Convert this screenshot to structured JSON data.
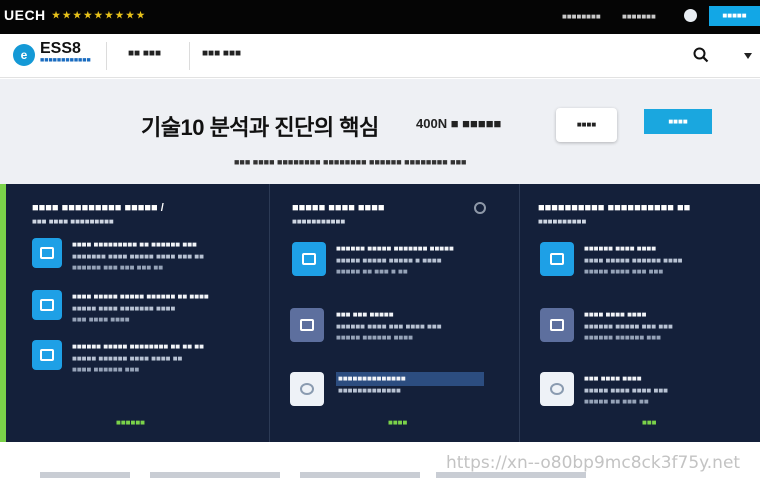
{
  "topbar": {
    "brand": "UECH",
    "tagline": "★ ★ ★ ★ ★ ★ ★ ★ ★",
    "links": [
      "■■■■■■■■",
      "■■■■■■■"
    ],
    "cta_label": "■■■■■"
  },
  "nav": {
    "logo_mark": "e",
    "logo_text": "ESS8",
    "logo_sub": "■■■■■■■■■■■■",
    "items": [
      "■■ ■■■",
      "■■■ ■■■"
    ]
  },
  "hero": {
    "headline": "기술10 분석과 진단의 핵심",
    "headline_suffix": "400N ■ ■■■■■",
    "btn_white": "■■■■",
    "btn_blue": "■■■■",
    "subline": "■■■ ■■■■ ■■■■■■■■ ■■■■■■■■ ■■■■■■ ■■■■■■■■ ■■■"
  },
  "columns": [
    {
      "title": "■■■■ ■■■■■■■■■ ■■■■■ /",
      "subtitle": "■■■ ■■■■ ■■■■■■■■■",
      "items": [
        {
          "icon": "monitor-icon",
          "l1": "■■■■ ■■■■■■■■■ ■■ ■■■■■■ ■■■",
          "l2": "■■■■■■■ ■■■■ ■■■■■ ■■■■ ■■■ ■■",
          "l3": "■■■■■■ ■■■ ■■■ ■■■ ■■"
        },
        {
          "icon": "document-icon",
          "l1": "■■■■ ■■■■■ ■■■■■ ■■■■■■ ■■ ■■■■",
          "l2": "■■■■■ ■■■■ ■■■■■■■ ■■■■",
          "l3": "■■■ ■■■■ ■■■■"
        },
        {
          "icon": "chart-icon",
          "l1": "■■■■■■ ■■■■■ ■■■■■■■■ ■■ ■■ ■■",
          "l2": "■■■■■ ■■■■■■ ■■■■ ■■■■ ■■",
          "l3": "■■■■ ■■■■■■ ■■■"
        }
      ],
      "footer": "■■■■■■"
    },
    {
      "title": "■■■■■ ■■■■ ■■■■",
      "subtitle": "■■■■■■■■■■■",
      "items": [
        {
          "icon": "tablet-icon",
          "l1": "■■■■■■ ■■■■■ ■■■■■■■ ■■■■■",
          "l2": "■■■■■ ■■■■■ ■■■■■ ■ ■■■■",
          "l3": "■■■■■ ■■ ■■■ ■ ■■"
        },
        {
          "icon": "gear-icon",
          "l1": "■■■ ■■■ ■■■■■",
          "l2": "■■■■■■ ■■■■ ■■■ ■■■■ ■■■",
          "l3": "■■■■■ ■■■■■■ ■■■■"
        },
        {
          "icon": "disc-icon",
          "l1": "■■■■■■■■■■■■■■",
          "l2": "■■■■■■■■■■■■■",
          "l3": ""
        }
      ],
      "footer": "■■■■"
    },
    {
      "title": "■■■■■■■■■■ ■■■■■■■■■■ ■■",
      "subtitle": "■■■■■■■■■■",
      "items": [
        {
          "icon": "window-icon",
          "l1": "■■■■■■ ■■■■ ■■■■",
          "l2": "■■■■ ■■■■■ ■■■■■■ ■■■■",
          "l3": "■■■■■ ■■■■ ■■■ ■■■"
        },
        {
          "icon": "calendar-icon",
          "l1": "■■■■ ■■■■ ■■■■",
          "l2": "■■■■■■ ■■■■■ ■■■ ■■■",
          "l3": "■■■■■■ ■■■■■■ ■■■"
        },
        {
          "icon": "clock-icon",
          "l1": "■■■ ■■■■ ■■■■",
          "l2": "■■■■■ ■■■■ ■■■■ ■■■",
          "l3": "■■■■■ ■■ ■■■ ■■"
        }
      ],
      "footer": "■■■"
    }
  ],
  "watermark": "https://xn--o80bp9mc8ck3f75y.net",
  "colors": {
    "accent_blue": "#1aa7df",
    "panel_bg": "#14203a",
    "accent_green": "#7bd24a"
  }
}
